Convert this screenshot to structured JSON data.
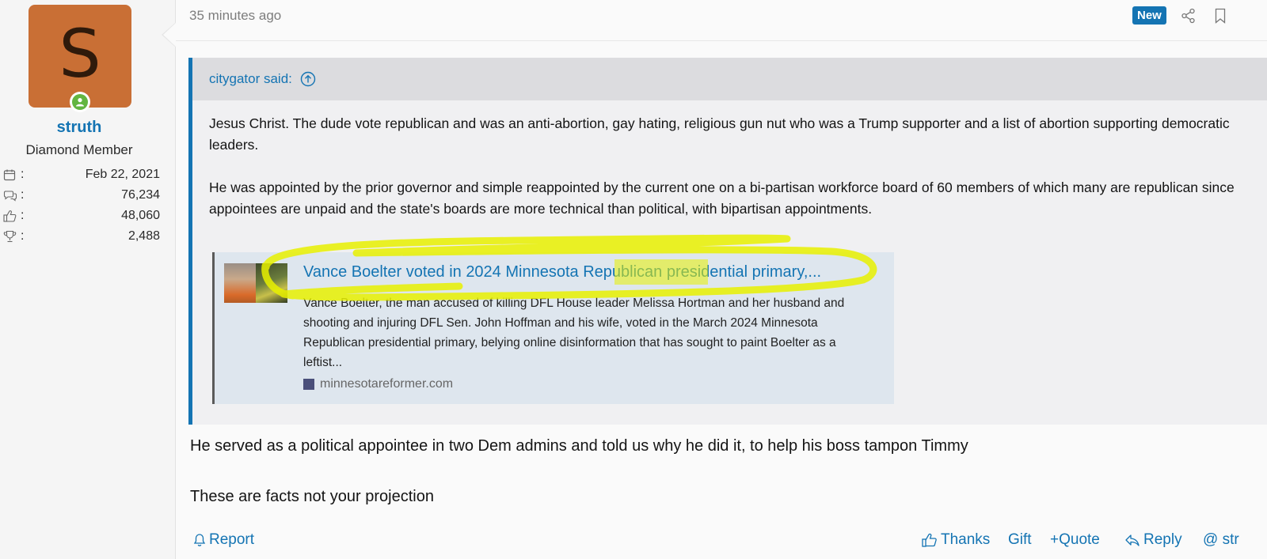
{
  "user": {
    "avatar_letter": "S",
    "avatar_color": "#c96f35",
    "online_color": "#63b540",
    "username": "struth",
    "title": "Diamond Member",
    "stats": [
      {
        "icon": "calendar-icon",
        "value": "Feb 22, 2021"
      },
      {
        "icon": "messages-icon",
        "value": "76,234"
      },
      {
        "icon": "thumbs-up-icon",
        "value": "48,060"
      },
      {
        "icon": "trophy-icon",
        "value": "2,488"
      }
    ]
  },
  "post": {
    "timestamp": "35 minutes ago",
    "new_badge": "New",
    "quote": {
      "author": "citygator said:",
      "paragraphs": [
        "Jesus Christ. The dude vote republican and was an anti-abortion, gay hating, religious gun nut who was a Trump supporter and a list of abortion supporting democratic leaders.",
        "He was appointed by the prior governor and simple reappointed by the current one on a bi-partisan workforce board of 60 members of which many are republican since appointees are unpaid and the state's boards are more technical than political, with bipartisan appointments."
      ],
      "embed": {
        "title": "Vance Boelter voted in 2024 Minnesota Republican presidential primary,...",
        "description": "Vance Boelter, the man accused of killing DFL House leader Melissa Hortman and her husband and shooting and injuring DFL Sen. John Hoffman and his wife, voted in the March 2024 Minnesota Republican presidential primary, belying online disinformation that has sought to paint Boelter as a leftist...",
        "site": "minnesotareformer.com"
      }
    },
    "body": [
      "He served as a political appointee in two Dem admins and told us why he did it, to help his boss tampon Timmy",
      "These are facts not your projection"
    ]
  },
  "actions": {
    "report": "Report",
    "thanks": "Thanks",
    "gift": "Gift",
    "quote": "+Quote",
    "reply": "Reply",
    "mention": "@ str"
  },
  "colors": {
    "accent": "#1474b3",
    "highlighter": "#e8f000"
  }
}
